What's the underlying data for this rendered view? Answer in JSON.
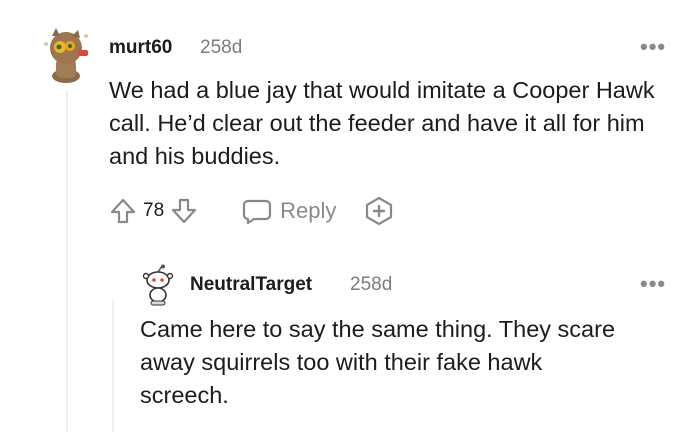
{
  "comment": {
    "username": "murt60",
    "timestamp": "258d",
    "body": "We had a blue jay that would imitate a Cooper Hawk call. He’d clear out the feeder and have it all for him and his buddies.",
    "votes": "78",
    "reply_label": "Reply",
    "more_label": "•••"
  },
  "reply": {
    "username": "NeutralTarget",
    "timestamp": "258d",
    "body": "Came here to say the same thing. They scare away squirrels too with their fake hawk screech.",
    "more_label": "•••"
  },
  "colors": {
    "meta": "#878a8c",
    "text": "#1c1c1c",
    "thread_line": "#edeff1"
  }
}
